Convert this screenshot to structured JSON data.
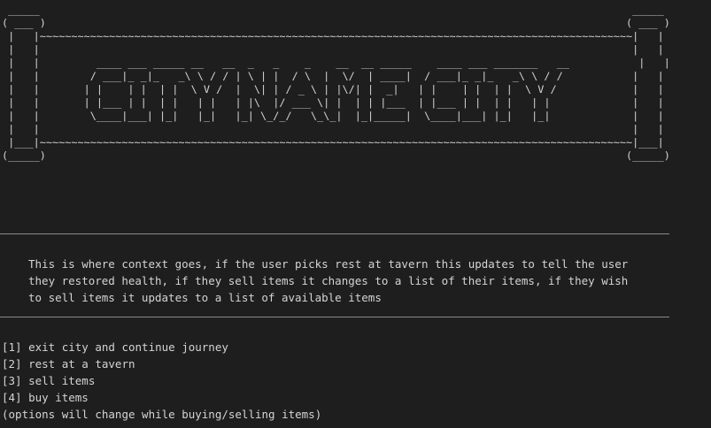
{
  "banner": {
    "ascii_art": " _____                                                                                              _____\n( ___ )                                                                                            ( ___ )\n |   |~~~~~~~~~~~~~~~~~~~~~~~~~~~~~~~~~~~~~~~~~~~~~~~~~~~~~~~~~~~~~~~~~~~~~~~~~~~~~~~~~~~~~~~~~~~~~~|   |\n |   |                                                                                              |   |\n |   |         ____ ___ _____ __   __  _   _    _    __  __ _____    ____ ___ _______   __           |   |\n |   |        / ___|_ _|_   _\\ \\ / / | \\ | |  / \\  |  \\/  | ____|  / ___|_ _|_   _\\ \\ / /           |   |\n |   |       | |    | |  | |  \\ V /  |  \\| | / _ \\ | |\\/| |  _|   | |    | |  | |  \\ V /            |   |\n |   |       | |___ | |  | |   | |   | |\\  |/ ___ \\| |  | | |___  | |___ | |  | |   | |             |   |\n |   |        \\____|___| |_|   |_|   |_| \\_/_/   \\_\\_|  |_|_____|  \\____|___| |_|   |_|             |   |\n |   |                                                                                              |   |\n |___|~~~~~~~~~~~~~~~~~~~~~~~~~~~~~~~~~~~~~~~~~~~~~~~~~~~~~~~~~~~~~~~~~~~~~~~~~~~~~~~~~~~~~~~~~~~~~~|___|\n(_____)                                                                                            (_____)"
  },
  "context": {
    "lines": [
      "This is where context goes, if the user picks rest at tavern this updates to tell the user",
      "they restored health, if they sell items it changes to a list of their items, if they wish",
      "to sell items it updates to a list of available items"
    ]
  },
  "menu": {
    "options": [
      "[1] exit city and continue journey",
      "[2] rest at a tavern",
      "[3] sell items",
      "[4] buy items"
    ],
    "note": "(options will change while buying/selling items)"
  }
}
